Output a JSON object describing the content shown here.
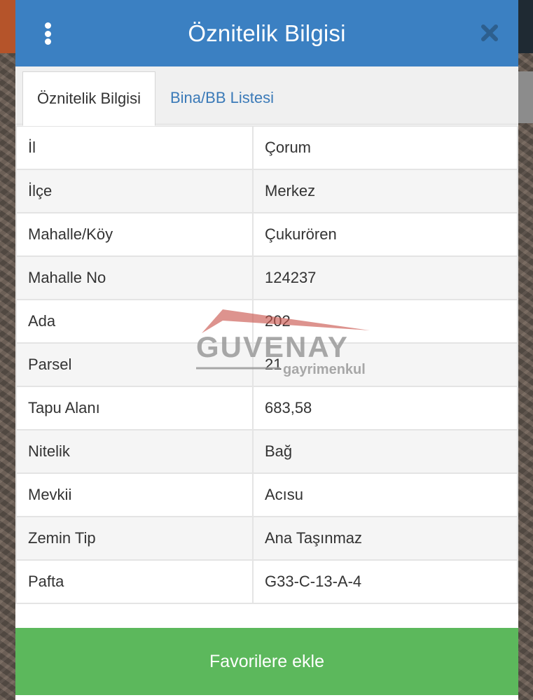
{
  "header": {
    "title": "Öznitelik Bilgisi",
    "menu_icon": "vertical-ellipsis-icon",
    "close_icon": "close-icon",
    "color": "#3b80c2"
  },
  "tabs": [
    {
      "label": "Öznitelik Bilgisi",
      "active": true
    },
    {
      "label": "Bina/BB Listesi",
      "active": false
    }
  ],
  "attributes": [
    {
      "key": "İl",
      "value": "Çorum"
    },
    {
      "key": "İlçe",
      "value": "Merkez"
    },
    {
      "key": "Mahalle/Köy",
      "value": "Çukurören"
    },
    {
      "key": "Mahalle No",
      "value": "124237"
    },
    {
      "key": "Ada",
      "value": "202"
    },
    {
      "key": "Parsel",
      "value": "21"
    },
    {
      "key": "Tapu Alanı",
      "value": "683,58"
    },
    {
      "key": "Nitelik",
      "value": "Bağ"
    },
    {
      "key": "Mevkii",
      "value": "Acısu"
    },
    {
      "key": "Zemin Tip",
      "value": "Ana Taşınmaz"
    },
    {
      "key": "Pafta",
      "value": "G33-C-13-A-4"
    }
  ],
  "watermark": {
    "brand": "GUVENAY",
    "sub": "gayrimenkul"
  },
  "footer": {
    "favorite_label": "Favorilere ekle",
    "color": "#5cb85c"
  }
}
